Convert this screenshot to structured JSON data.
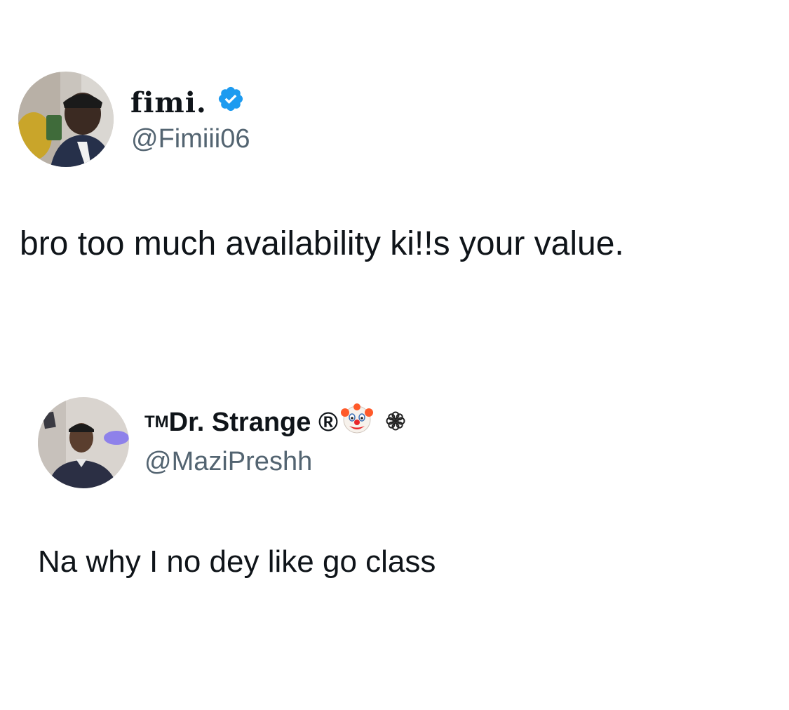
{
  "posts": [
    {
      "display_name": "fimi.",
      "handle": "@Fimiii06",
      "verified": true,
      "text": "bro too much availability ki!!s your value.",
      "avatar_icon": "profile-photo",
      "badge_icon": "verified-badge-icon",
      "badge_color": "#1d9bf0"
    },
    {
      "display_name": "Dr. Strange ®",
      "name_prefix": "TM",
      "handle": "@MaziPreshh",
      "text": "Na why I no dey like go class",
      "avatar_icon": "profile-photo",
      "name_icons": [
        "clown-face-emoji-icon",
        "flower-icon"
      ]
    }
  ],
  "colors": {
    "text": "#0f1419",
    "handle": "#536471",
    "verified": "#1d9bf0",
    "background": "#ffffff"
  }
}
